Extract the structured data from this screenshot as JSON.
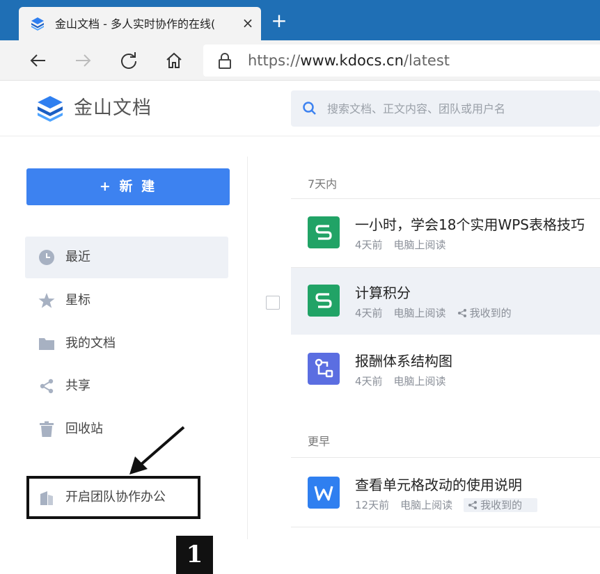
{
  "browser": {
    "tab_title": "金山文档 - 多人实时协作的在线(",
    "tab_close": "×",
    "new_tab": "+",
    "url": {
      "scheme": "https://",
      "host": "www.kdocs.cn",
      "path": "/latest"
    }
  },
  "app": {
    "brand_name": "金山文档",
    "search_placeholder": "搜索文档、正文内容、团队或用户名"
  },
  "sidebar": {
    "new_button": "+ 新 建",
    "items": [
      {
        "label": "最近",
        "icon": "clock-icon"
      },
      {
        "label": "星标",
        "icon": "star-icon"
      },
      {
        "label": "我的文档",
        "icon": "folder-icon"
      },
      {
        "label": "共享",
        "icon": "share-icon"
      },
      {
        "label": "回收站",
        "icon": "trash-icon"
      }
    ],
    "team_label": "开启团队协作办公",
    "callout": "1"
  },
  "main": {
    "sections": [
      {
        "label": "7天内",
        "files": [
          {
            "title": "一小时，学会18个实用WPS表格技巧",
            "time": "4天前",
            "source": "电脑上阅读",
            "shared": "",
            "icon": "spreadsheet-icon"
          },
          {
            "title": "计算积分",
            "time": "4天前",
            "source": "电脑上阅读",
            "shared": "我收到的",
            "icon": "spreadsheet-icon"
          },
          {
            "title": "报酬体系结构图",
            "time": "4天前",
            "source": "电脑上阅读",
            "shared": "",
            "icon": "flowchart-icon"
          }
        ]
      },
      {
        "label": "更早",
        "files": [
          {
            "title": "查看单元格改动的使用说明",
            "time": "12天前",
            "source": "电脑上阅读",
            "shared": "我收到的",
            "icon": "word-document-icon"
          }
        ]
      }
    ]
  },
  "colors": {
    "tabbar": "#1f6fb5",
    "primary": "#3d82f0",
    "spreadsheet": "#21a366",
    "flowchart": "#5b6ee1",
    "word": "#2f7ff0"
  }
}
